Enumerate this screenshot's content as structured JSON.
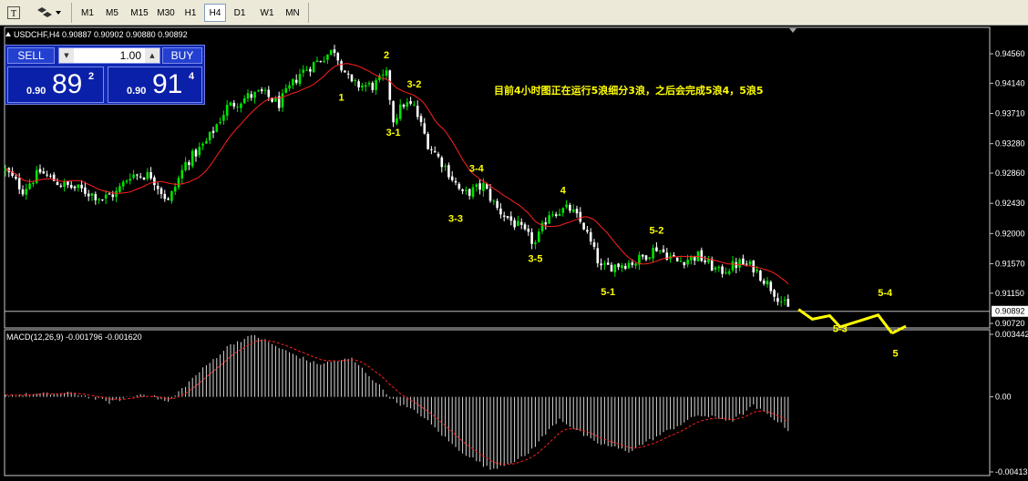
{
  "toolbar": {
    "timeframes": [
      "M1",
      "M5",
      "M15",
      "M30",
      "H1",
      "H4",
      "D1",
      "W1",
      "MN"
    ],
    "active": "H4"
  },
  "chart_data": [
    {
      "type": "candlestick",
      "symbol_header": "USDCHF,H4  0.90887 0.90902 0.90880 0.90892",
      "ylim": [
        0.9072,
        0.9456
      ],
      "y_ticks": [
        "0.94560",
        "0.94140",
        "0.93710",
        "0.93280",
        "0.92860",
        "0.92430",
        "0.92000",
        "0.91570",
        "0.91150",
        "0.90720"
      ],
      "current_price": "0.90892",
      "close_path": [
        {
          "i": 0,
          "v": 0.929
        },
        {
          "i": 5,
          "v": 0.9262
        },
        {
          "i": 10,
          "v": 0.9288
        },
        {
          "i": 16,
          "v": 0.927
        },
        {
          "i": 22,
          "v": 0.9262
        },
        {
          "i": 28,
          "v": 0.925
        },
        {
          "i": 32,
          "v": 0.9258
        },
        {
          "i": 36,
          "v": 0.9284
        },
        {
          "i": 42,
          "v": 0.9283
        },
        {
          "i": 47,
          "v": 0.9245
        },
        {
          "i": 52,
          "v": 0.93
        },
        {
          "i": 58,
          "v": 0.933
        },
        {
          "i": 64,
          "v": 0.938
        },
        {
          "i": 70,
          "v": 0.9395
        },
        {
          "i": 74,
          "v": 0.94
        },
        {
          "i": 79,
          "v": 0.9385
        },
        {
          "i": 85,
          "v": 0.9428
        },
        {
          "i": 90,
          "v": 0.9445
        },
        {
          "i": 95,
          "v": 0.9462
        },
        {
          "i": 97,
          "v": 0.944
        },
        {
          "i": 100,
          "v": 0.9412
        },
        {
          "i": 106,
          "v": 0.941
        },
        {
          "i": 110,
          "v": 0.9425
        },
        {
          "i": 112,
          "v": 0.9362
        },
        {
          "i": 115,
          "v": 0.9385
        },
        {
          "i": 118,
          "v": 0.938
        },
        {
          "i": 122,
          "v": 0.9328
        },
        {
          "i": 127,
          "v": 0.9295
        },
        {
          "i": 132,
          "v": 0.9255
        },
        {
          "i": 138,
          "v": 0.9268
        },
        {
          "i": 142,
          "v": 0.9235
        },
        {
          "i": 148,
          "v": 0.921
        },
        {
          "i": 153,
          "v": 0.9185
        },
        {
          "i": 157,
          "v": 0.923
        },
        {
          "i": 163,
          "v": 0.9235
        },
        {
          "i": 167,
          "v": 0.921
        },
        {
          "i": 172,
          "v": 0.915
        },
        {
          "i": 176,
          "v": 0.9155
        },
        {
          "i": 182,
          "v": 0.916
        },
        {
          "i": 188,
          "v": 0.918
        },
        {
          "i": 194,
          "v": 0.916
        },
        {
          "i": 200,
          "v": 0.9168
        },
        {
          "i": 206,
          "v": 0.9145
        },
        {
          "i": 212,
          "v": 0.9158
        },
        {
          "i": 216,
          "v": 0.9152
        },
        {
          "i": 221,
          "v": 0.9123
        },
        {
          "i": 226,
          "v": 0.9092
        }
      ],
      "ma_period": 14,
      "wave_labels": [
        {
          "text": "1",
          "i": 97,
          "v": 0.9405,
          "pos": "below"
        },
        {
          "text": "2",
          "i": 110,
          "v": 0.9442,
          "pos": "above"
        },
        {
          "text": "3-1",
          "i": 112,
          "v": 0.9355,
          "pos": "below"
        },
        {
          "text": "3-2",
          "i": 118,
          "v": 0.94,
          "pos": "above"
        },
        {
          "text": "3-3",
          "i": 130,
          "v": 0.9232,
          "pos": "below"
        },
        {
          "text": "3-4",
          "i": 136,
          "v": 0.928,
          "pos": "above"
        },
        {
          "text": "3-5",
          "i": 153,
          "v": 0.9175,
          "pos": "below"
        },
        {
          "text": "4",
          "i": 161,
          "v": 0.9249,
          "pos": "above"
        },
        {
          "text": "5-1",
          "i": 174,
          "v": 0.9128,
          "pos": "below"
        },
        {
          "text": "5-2",
          "i": 188,
          "v": 0.9192,
          "pos": "above"
        },
        {
          "text": "5-4",
          "i": 254,
          "v": 0.9103,
          "pos": "above"
        },
        {
          "text": "5-3",
          "i": 241,
          "v": 0.9075,
          "pos": "below"
        },
        {
          "text": "5",
          "i": 257,
          "v": 0.904,
          "pos": "below"
        }
      ],
      "projection": [
        {
          "i": 229,
          "v": 0.9092
        },
        {
          "i": 233,
          "v": 0.9078
        },
        {
          "i": 238,
          "v": 0.9083
        },
        {
          "i": 241,
          "v": 0.9067
        },
        {
          "i": 252,
          "v": 0.9084
        },
        {
          "i": 256,
          "v": 0.9058
        }
      ],
      "projection_tail": {
        "i": 260,
        "v": 0.9068
      },
      "annotation": "目前4小时图正在运行5浪细分3浪，之后会完成5浪4，5浪5"
    },
    {
      "type": "histogram",
      "header": "MACD(12,26,9) -0.001796 -0.001620",
      "ylim": [
        -0.00413,
        0.003442
      ],
      "y_ticks": [
        "0.003442",
        "0.00",
        "-0.00413"
      ],
      "macd_path": [
        {
          "i": 0,
          "v": 0.0001
        },
        {
          "i": 20,
          "v": 0.0002
        },
        {
          "i": 30,
          "v": -0.0003
        },
        {
          "i": 40,
          "v": 0.0002
        },
        {
          "i": 47,
          "v": -0.0003
        },
        {
          "i": 55,
          "v": 0.0012
        },
        {
          "i": 65,
          "v": 0.0029
        },
        {
          "i": 72,
          "v": 0.0034
        },
        {
          "i": 80,
          "v": 0.0026
        },
        {
          "i": 90,
          "v": 0.0018
        },
        {
          "i": 100,
          "v": 0.0021
        },
        {
          "i": 106,
          "v": 0.001
        },
        {
          "i": 112,
          "v": -0.0002
        },
        {
          "i": 120,
          "v": -0.001
        },
        {
          "i": 130,
          "v": -0.0028
        },
        {
          "i": 140,
          "v": -0.004
        },
        {
          "i": 150,
          "v": -0.0033
        },
        {
          "i": 160,
          "v": -0.0012
        },
        {
          "i": 170,
          "v": -0.0025
        },
        {
          "i": 180,
          "v": -0.003
        },
        {
          "i": 190,
          "v": -0.002
        },
        {
          "i": 200,
          "v": -0.001
        },
        {
          "i": 210,
          "v": -0.0013
        },
        {
          "i": 216,
          "v": -0.0005
        },
        {
          "i": 222,
          "v": -0.0012
        },
        {
          "i": 226,
          "v": -0.0018
        }
      ]
    }
  ],
  "trade_panel": {
    "sell_label": "SELL",
    "buy_label": "BUY",
    "lot": "1.00",
    "sell_prefix": "0.90",
    "sell_big": "89",
    "sell_sup": "2",
    "buy_prefix": "0.90",
    "buy_big": "91",
    "buy_sup": "4"
  },
  "colors": {
    "bull": "#00e400",
    "bear": "#ffffff",
    "ma": "#ff2020",
    "labels": "#ffff00",
    "axis_text": "#ffffff",
    "signal": "#ff2020"
  }
}
